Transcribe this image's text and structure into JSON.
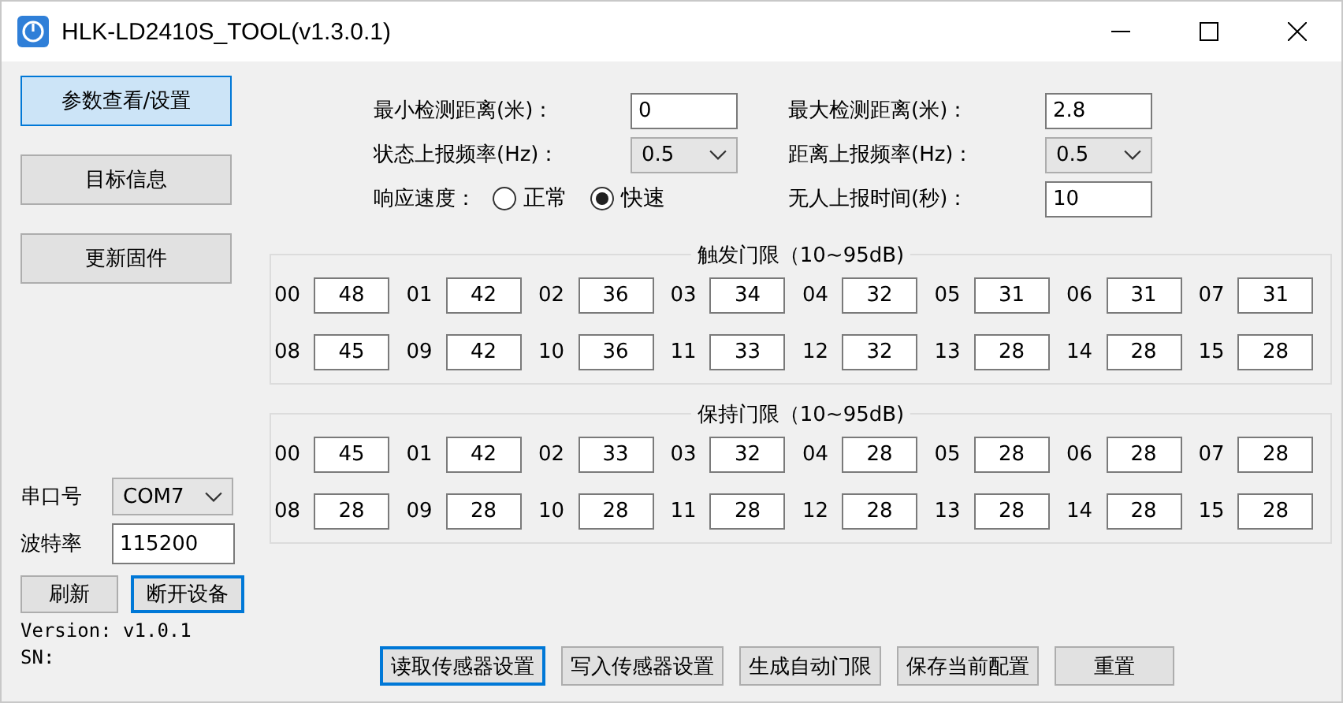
{
  "window": {
    "title": "HLK-LD2410S_TOOL(v1.3.0.1)"
  },
  "nav": [
    {
      "label": "参数查看/设置",
      "selected": true
    },
    {
      "label": "目标信息",
      "selected": false
    },
    {
      "label": "更新固件",
      "selected": false
    }
  ],
  "settings": [
    {
      "kind": "input",
      "label": "最小检测距离(米)：",
      "value": "0"
    },
    {
      "kind": "input",
      "label": "最大检测距离(米)：",
      "value": "2.8"
    },
    {
      "kind": "select",
      "label": "状态上报频率(Hz)：",
      "value": "0.5"
    },
    {
      "kind": "select",
      "label": "距离上报频率(Hz)：",
      "value": "0.5"
    },
    {
      "kind": "radio",
      "label": "响应速度：",
      "options": [
        {
          "label": "正常",
          "selected": false
        },
        {
          "label": "快速",
          "selected": true
        }
      ]
    },
    {
      "kind": "input",
      "label": "无人上报时间(秒)：",
      "value": "10"
    }
  ],
  "thresholds": [
    {
      "title": "触发门限（10~95dB)",
      "cells": [
        {
          "gate": "00",
          "value": "48"
        },
        {
          "gate": "01",
          "value": "42"
        },
        {
          "gate": "02",
          "value": "36"
        },
        {
          "gate": "03",
          "value": "34"
        },
        {
          "gate": "04",
          "value": "32"
        },
        {
          "gate": "05",
          "value": "31"
        },
        {
          "gate": "06",
          "value": "31"
        },
        {
          "gate": "07",
          "value": "31"
        },
        {
          "gate": "08",
          "value": "45"
        },
        {
          "gate": "09",
          "value": "42"
        },
        {
          "gate": "10",
          "value": "36"
        },
        {
          "gate": "11",
          "value": "33"
        },
        {
          "gate": "12",
          "value": "32"
        },
        {
          "gate": "13",
          "value": "28"
        },
        {
          "gate": "14",
          "value": "28"
        },
        {
          "gate": "15",
          "value": "28"
        }
      ]
    },
    {
      "title": "保持门限（10~95dB)",
      "cells": [
        {
          "gate": "00",
          "value": "45"
        },
        {
          "gate": "01",
          "value": "42"
        },
        {
          "gate": "02",
          "value": "33"
        },
        {
          "gate": "03",
          "value": "32"
        },
        {
          "gate": "04",
          "value": "28"
        },
        {
          "gate": "05",
          "value": "28"
        },
        {
          "gate": "06",
          "value": "28"
        },
        {
          "gate": "07",
          "value": "28"
        },
        {
          "gate": "08",
          "value": "28"
        },
        {
          "gate": "09",
          "value": "28"
        },
        {
          "gate": "10",
          "value": "28"
        },
        {
          "gate": "11",
          "value": "28"
        },
        {
          "gate": "12",
          "value": "28"
        },
        {
          "gate": "13",
          "value": "28"
        },
        {
          "gate": "14",
          "value": "28"
        },
        {
          "gate": "15",
          "value": "28"
        }
      ]
    }
  ],
  "serial": {
    "port_label": "串口号",
    "port": "COM7",
    "baud_label": "波特率",
    "baud": "115200"
  },
  "serial_buttons": [
    {
      "label": "刷新",
      "focused": false
    },
    {
      "label": "断开设备",
      "focused": true
    }
  ],
  "version": "Version: v1.0.1",
  "sn": "SN:",
  "actions": [
    {
      "label": "读取传感器设置",
      "focused": true
    },
    {
      "label": "写入传感器设置",
      "focused": false
    },
    {
      "label": "生成自动门限",
      "focused": false
    },
    {
      "label": "保存当前配置",
      "focused": false
    },
    {
      "label": "重置",
      "focused": false
    }
  ]
}
